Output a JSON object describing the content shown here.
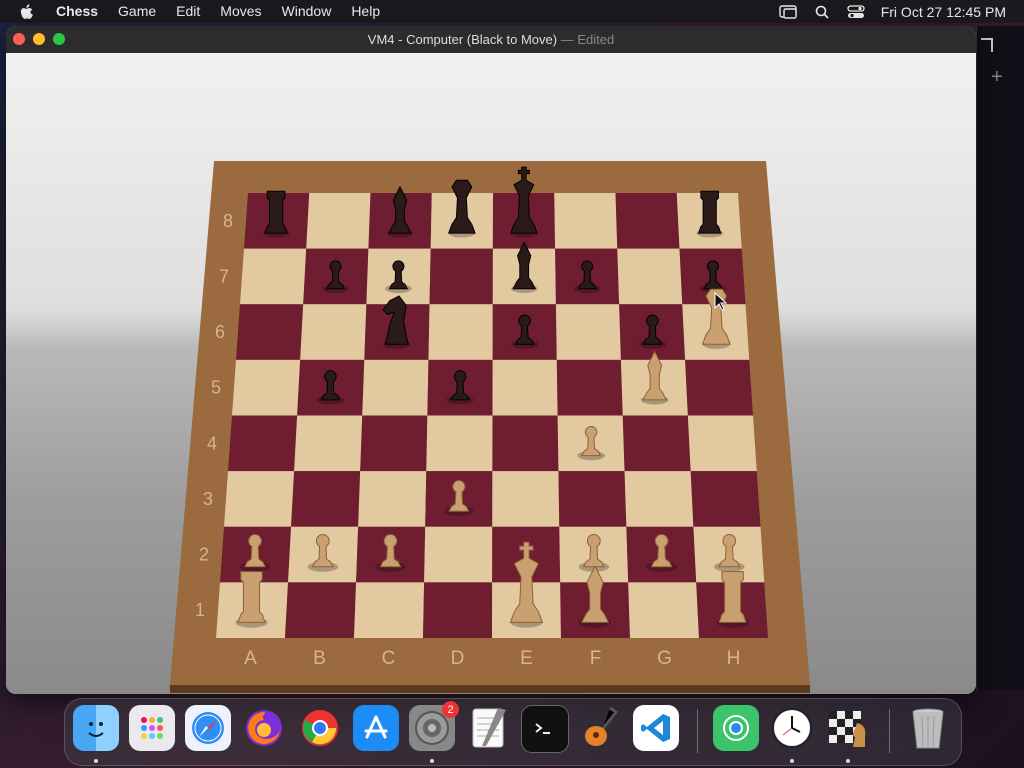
{
  "menubar": {
    "app_name": "Chess",
    "menus": [
      "Game",
      "Edit",
      "Moves",
      "Window",
      "Help"
    ],
    "clock": "Fri Oct 27  12:45 PM",
    "status_icons": [
      "screen-mirroring-icon",
      "search-icon",
      "control-center-icon"
    ]
  },
  "window": {
    "title": "VM4 - Computer   (Black to Move)",
    "title_separator": "—",
    "edited": "Edited"
  },
  "board": {
    "ranks": [
      "8",
      "7",
      "6",
      "5",
      "4",
      "3",
      "2",
      "1"
    ],
    "files": [
      "A",
      "B",
      "C",
      "D",
      "E",
      "F",
      "G",
      "H"
    ],
    "colors": {
      "light": "#e3c9a0",
      "dark": "#6e1e30",
      "frame": "#9b6a3f",
      "white_piece": "#caa070",
      "black_piece": "#2a1a1a"
    },
    "pieces": [
      {
        "square": "a8",
        "color": "black",
        "type": "rook"
      },
      {
        "square": "c8",
        "color": "black",
        "type": "bishop"
      },
      {
        "square": "d8",
        "color": "black",
        "type": "queen"
      },
      {
        "square": "e8",
        "color": "black",
        "type": "king"
      },
      {
        "square": "h8",
        "color": "black",
        "type": "rook"
      },
      {
        "square": "b7",
        "color": "black",
        "type": "pawn"
      },
      {
        "square": "c7",
        "color": "black",
        "type": "pawn"
      },
      {
        "square": "e7",
        "color": "black",
        "type": "bishop"
      },
      {
        "square": "f7",
        "color": "black",
        "type": "pawn"
      },
      {
        "square": "h7",
        "color": "black",
        "type": "pawn"
      },
      {
        "square": "c6",
        "color": "black",
        "type": "knight"
      },
      {
        "square": "e6",
        "color": "black",
        "type": "pawn"
      },
      {
        "square": "g6",
        "color": "black",
        "type": "pawn"
      },
      {
        "square": "b5",
        "color": "black",
        "type": "pawn"
      },
      {
        "square": "d5",
        "color": "black",
        "type": "pawn"
      },
      {
        "square": "h6",
        "color": "white",
        "type": "queen"
      },
      {
        "square": "g5",
        "color": "white",
        "type": "bishop"
      },
      {
        "square": "f4",
        "color": "white",
        "type": "pawn"
      },
      {
        "square": "d3",
        "color": "white",
        "type": "pawn"
      },
      {
        "square": "a2",
        "color": "white",
        "type": "pawn"
      },
      {
        "square": "b2",
        "color": "white",
        "type": "pawn"
      },
      {
        "square": "c2",
        "color": "white",
        "type": "pawn"
      },
      {
        "square": "f2",
        "color": "white",
        "type": "pawn"
      },
      {
        "square": "g2",
        "color": "white",
        "type": "pawn"
      },
      {
        "square": "h2",
        "color": "white",
        "type": "pawn"
      },
      {
        "square": "a1",
        "color": "white",
        "type": "rook"
      },
      {
        "square": "e1",
        "color": "white",
        "type": "king"
      },
      {
        "square": "f1",
        "color": "white",
        "type": "bishop"
      },
      {
        "square": "h1",
        "color": "white",
        "type": "rook"
      }
    ]
  },
  "dock": {
    "items": [
      {
        "name": "finder",
        "icon": "finder-icon",
        "running": true
      },
      {
        "name": "launchpad",
        "icon": "launchpad-icon",
        "running": false
      },
      {
        "name": "safari",
        "icon": "safari-icon",
        "running": false
      },
      {
        "name": "firefox",
        "icon": "firefox-icon",
        "running": false
      },
      {
        "name": "chrome",
        "icon": "chrome-icon",
        "running": false
      },
      {
        "name": "app-store",
        "icon": "app-store-icon",
        "running": false
      },
      {
        "name": "system-settings",
        "icon": "gear-icon",
        "running": true,
        "badge": "2"
      },
      {
        "name": "textedit",
        "icon": "textedit-icon",
        "running": false
      },
      {
        "name": "terminal",
        "icon": "terminal-icon",
        "running": false
      },
      {
        "name": "garageband",
        "icon": "guitar-icon",
        "running": false
      },
      {
        "name": "vscode",
        "icon": "vscode-icon",
        "running": false
      },
      {
        "name": "find-my",
        "icon": "find-my-icon",
        "running": false
      },
      {
        "name": "clock",
        "icon": "clock-icon",
        "running": true
      },
      {
        "name": "chess",
        "icon": "chess-icon",
        "running": true
      },
      {
        "name": "trash",
        "icon": "trash-icon",
        "running": false
      }
    ]
  }
}
